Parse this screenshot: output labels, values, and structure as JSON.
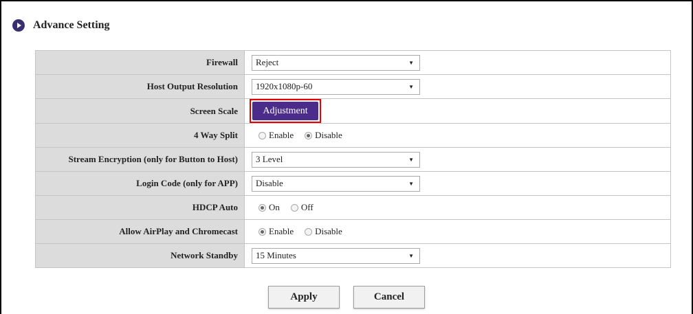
{
  "header": {
    "title": "Advance Setting",
    "icon": "play-circle-icon"
  },
  "rows": [
    {
      "label": "Firewall",
      "type": "select",
      "value": "Reject"
    },
    {
      "label": "Host Output Resolution",
      "type": "select",
      "value": "1920x1080p-60"
    },
    {
      "label": "Screen Scale",
      "type": "button",
      "value": "Adjustment"
    },
    {
      "label": "4 Way Split",
      "type": "radio",
      "options": [
        "Enable",
        "Disable"
      ],
      "selected": "Disable"
    },
    {
      "label": "Stream Encryption (only for Button to Host)",
      "type": "select",
      "value": "3 Level"
    },
    {
      "label": "Login Code (only for APP)",
      "type": "select",
      "value": "Disable"
    },
    {
      "label": "HDCP Auto",
      "type": "radio",
      "options": [
        "On",
        "Off"
      ],
      "selected": "On"
    },
    {
      "label": "Allow AirPlay and Chromecast",
      "type": "radio",
      "options": [
        "Enable",
        "Disable"
      ],
      "selected": "Enable"
    },
    {
      "label": "Network Standby",
      "type": "select",
      "value": "15 Minutes"
    }
  ],
  "actions": {
    "apply": "Apply",
    "cancel": "Cancel"
  },
  "colors": {
    "accent": "#4b2c8a",
    "highlight": "#e20000",
    "label_bg": "#dcdcdc"
  }
}
